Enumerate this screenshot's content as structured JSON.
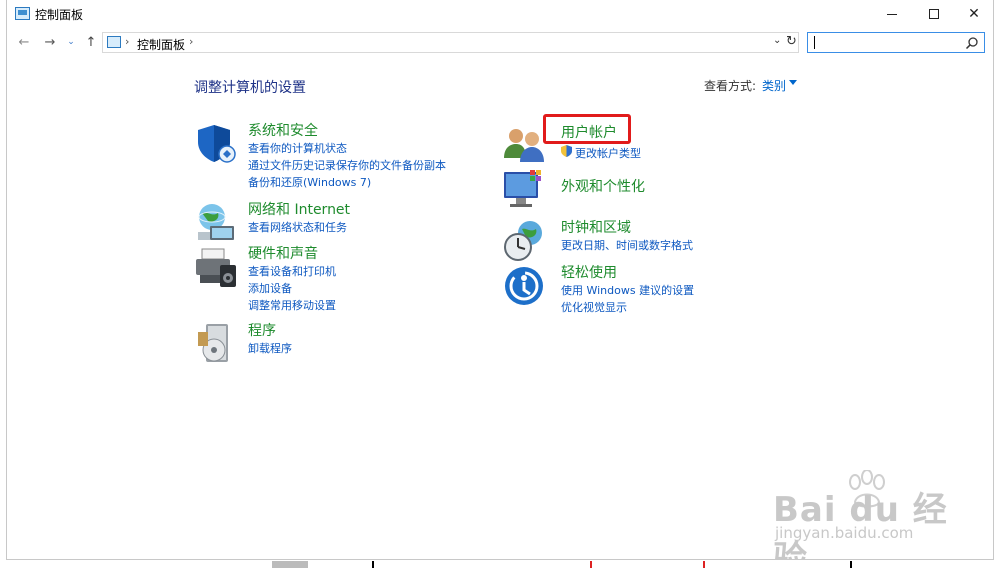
{
  "window": {
    "title": "控制面板",
    "buttons": {
      "minimize": "—",
      "maximize": "☐",
      "close": "✕"
    }
  },
  "navigation": {
    "back": "←",
    "forward": "→",
    "recent": "⌄",
    "up": "↑",
    "address": {
      "separator": "›",
      "crumb": "控制面板"
    },
    "dropdown": "⌄",
    "refresh": "↻",
    "search": {
      "value": "",
      "placeholder": ""
    }
  },
  "content": {
    "heading": "调整计算机的设置",
    "view_by_label": "查看方式:",
    "view_by_value": "类别",
    "categories_left": [
      {
        "title": "系统和安全",
        "icon": "shield-icon",
        "links": [
          "查看你的计算机状态",
          "通过文件历史记录保存你的文件备份副本",
          "备份和还原(Windows 7)"
        ]
      },
      {
        "title": "网络和 Internet",
        "icon": "network-globe-icon",
        "links": [
          "查看网络状态和任务"
        ]
      },
      {
        "title": "硬件和声音",
        "icon": "printer-speaker-icon",
        "links": [
          "查看设备和打印机",
          "添加设备",
          "调整常用移动设置"
        ]
      },
      {
        "title": "程序",
        "icon": "programs-disc-icon",
        "links": [
          "卸载程序"
        ]
      }
    ],
    "categories_right": [
      {
        "title": "用户帐户",
        "icon": "users-icon",
        "links": [
          "更改帐户类型"
        ]
      },
      {
        "title": "外观和个性化",
        "icon": "monitor-personalize-icon",
        "links": []
      },
      {
        "title": "时钟和区域",
        "icon": "clock-globe-icon",
        "links": [
          "更改日期、时间或数字格式"
        ]
      },
      {
        "title": "轻松使用",
        "icon": "ease-of-access-icon",
        "links": [
          "使用 Windows 建议的设置",
          "优化视觉显示"
        ]
      }
    ]
  },
  "watermark": {
    "brand": "Bai du 经验",
    "url": "jingyan.baidu.com"
  },
  "colors": {
    "category_title": "#1e8b2d",
    "link": "#0d58c0",
    "heading": "#1e3287",
    "highlight": "#e11b1b"
  }
}
